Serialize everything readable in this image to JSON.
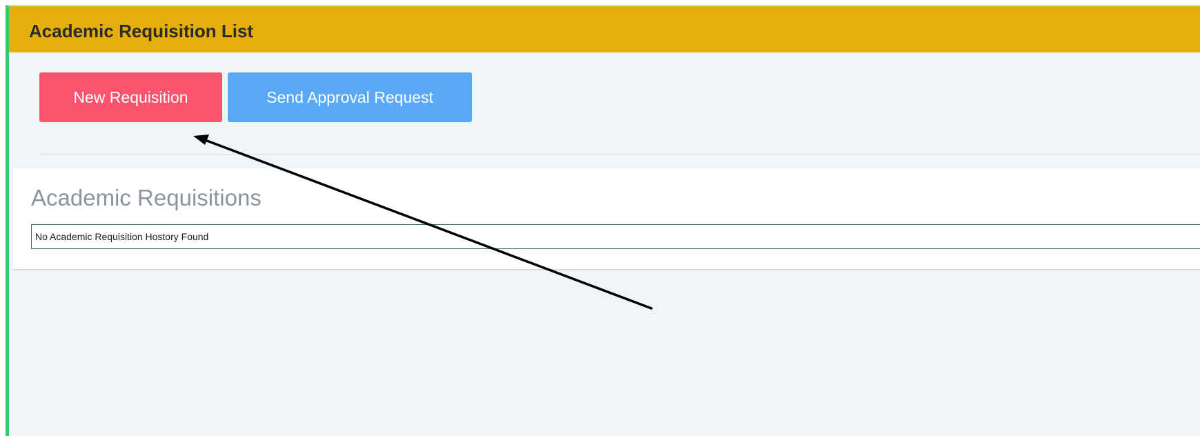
{
  "panel": {
    "title": "Academic Requisition List"
  },
  "toolbar": {
    "new_label": "New Requisition",
    "send_label": "Send Approval Request"
  },
  "requisitions": {
    "heading": "Academic Requisitions",
    "empty_message": "No Academic Requisition Hostory Found"
  },
  "colors": {
    "header_bg": "#e6ae0c",
    "new_button": "#f9546e",
    "send_button": "#5aa9f7",
    "left_accent": "#2ecc71",
    "page_bg": "#f0f5f9"
  },
  "annotation": {
    "icon": "arrow-icon"
  }
}
